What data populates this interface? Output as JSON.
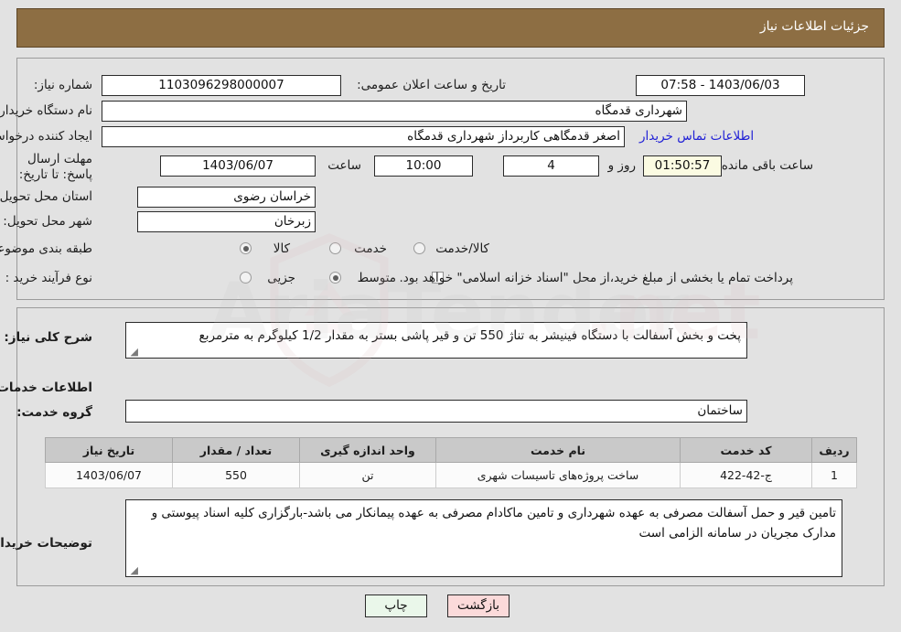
{
  "header": {
    "title": "جزئیات اطلاعات نیاز"
  },
  "form": {
    "need_number_label": "شماره نیاز:",
    "need_number_value": "1103096298000007",
    "announce_label": "تاریخ و ساعت اعلان عمومی:",
    "announce_value": "1403/06/03 - 07:58",
    "buyer_org_label": "نام دستگاه خریدار:",
    "buyer_org_value": "شهرداری قدمگاه",
    "creator_label": "ایجاد کننده درخواست:",
    "creator_value": "اصغر قدمگاهی کاربرداز شهرداری قدمگاه",
    "contact_link": "اطلاعات تماس خریدار",
    "deadline_label": "مهلت ارسال پاسخ: تا تاریخ:",
    "deadline_date": "1403/06/07",
    "deadline_hour_label": "ساعت",
    "deadline_hour": "10:00",
    "days_value": "4",
    "days_label": "روز و",
    "countdown": "01:50:57",
    "countdown_label": "ساعت باقی مانده",
    "province_label": "استان محل تحویل:",
    "province_value": "خراسان رضوی",
    "city_label": "شهر محل تحویل:",
    "city_value": "زبرخان",
    "category_label": "طبقه بندی موضوعی:",
    "category_options": [
      "کالا",
      "خدمت",
      "کالا/خدمت"
    ],
    "category_selected": "خدمت",
    "process_label": "نوع فرآیند خرید :",
    "process_options": [
      "جزیی",
      "متوسط"
    ],
    "process_selected": "متوسط",
    "treasury_note": "پرداخت تمام یا بخشی از مبلغ خرید،از محل \"اسناد خزانه اسلامی\" خواهد بود.",
    "treasury_checked": false
  },
  "details": {
    "general_desc_label": "شرح کلی نیاز:",
    "general_desc_value": "پخت و بخش آسفالت با دستگاه فینیشر به تناژ 550 تن و قیر پاشی بستر به مقدار 1/2 کیلوگرم به مترمربع",
    "services_title": "اطلاعات خدمات مورد نیاز",
    "service_group_label": "گروه خدمت:",
    "service_group_value": "ساختمان",
    "buyer_notes_label": "توضیحات خریدار:",
    "buyer_notes_value": "تامین قیر و حمل آسفالت مصرفی به عهده شهرداری و تامین ماکادام مصرفی به عهده پیمانکار می باشد-بارگزاری کلیه اسناد پیوستی و مدارک مجریان در سامانه الزامی است"
  },
  "table": {
    "headers": [
      "ردیف",
      "کد خدمت",
      "نام خدمت",
      "واحد اندازه گیری",
      "تعداد / مقدار",
      "تاریخ نیاز"
    ],
    "rows": [
      {
        "row": "1",
        "code": "ج-42-422",
        "name": "ساخت پروژه‌های تاسیسات شهری",
        "unit": "تن",
        "quantity": "550",
        "date": "1403/06/07"
      }
    ]
  },
  "buttons": {
    "print": "چاپ",
    "back": "بازگشت"
  },
  "colors": {
    "header_bar": "#8d6e43",
    "link": "#2121d6",
    "countdown_bg": "#fbfbe2",
    "print_bg": "#eaf7ea",
    "back_bg": "#fbdada"
  }
}
